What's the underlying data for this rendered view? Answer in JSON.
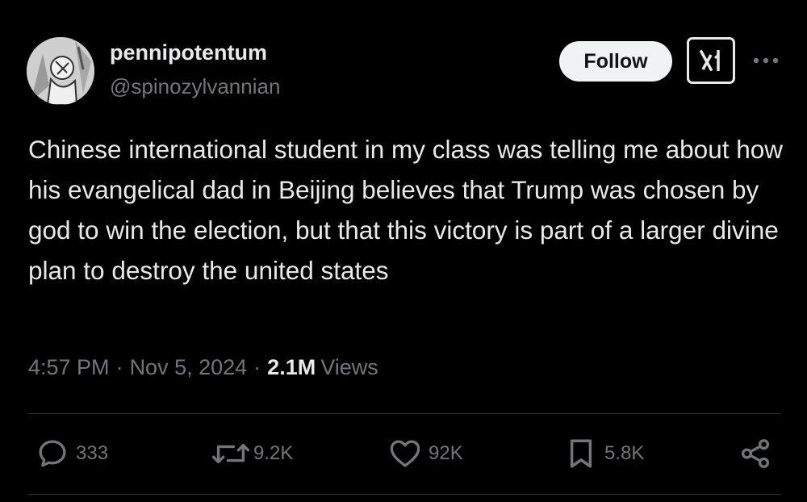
{
  "author": {
    "display_name": "pennipotentum",
    "handle": "@spinozylvannian"
  },
  "actions": {
    "follow_label": "Follow"
  },
  "tweet": {
    "text": "Chinese international student in my class was telling me about how his evangelical dad in Beijing believes that Trump was chosen by god to win the election, but that this victory is part of a larger divine plan to destroy the united states",
    "time": "4:57 PM",
    "date": "Nov 5, 2024",
    "views_count": "2.1M",
    "views_label": "Views",
    "separator": "·"
  },
  "engagement": {
    "replies": "333",
    "reposts": "9.2K",
    "likes": "92K",
    "bookmarks": "5.8K"
  },
  "icons": {
    "reply": "reply-icon",
    "repost": "repost-icon",
    "like": "heart-icon",
    "bookmark": "bookmark-icon",
    "share": "share-icon",
    "more": "more-icon",
    "grok": "grok-icon"
  },
  "colors": {
    "background": "#000000",
    "text_primary": "#e7e9ea",
    "text_secondary": "#71767b",
    "divider": "#2f3336",
    "follow_bg": "#eff3f4"
  }
}
